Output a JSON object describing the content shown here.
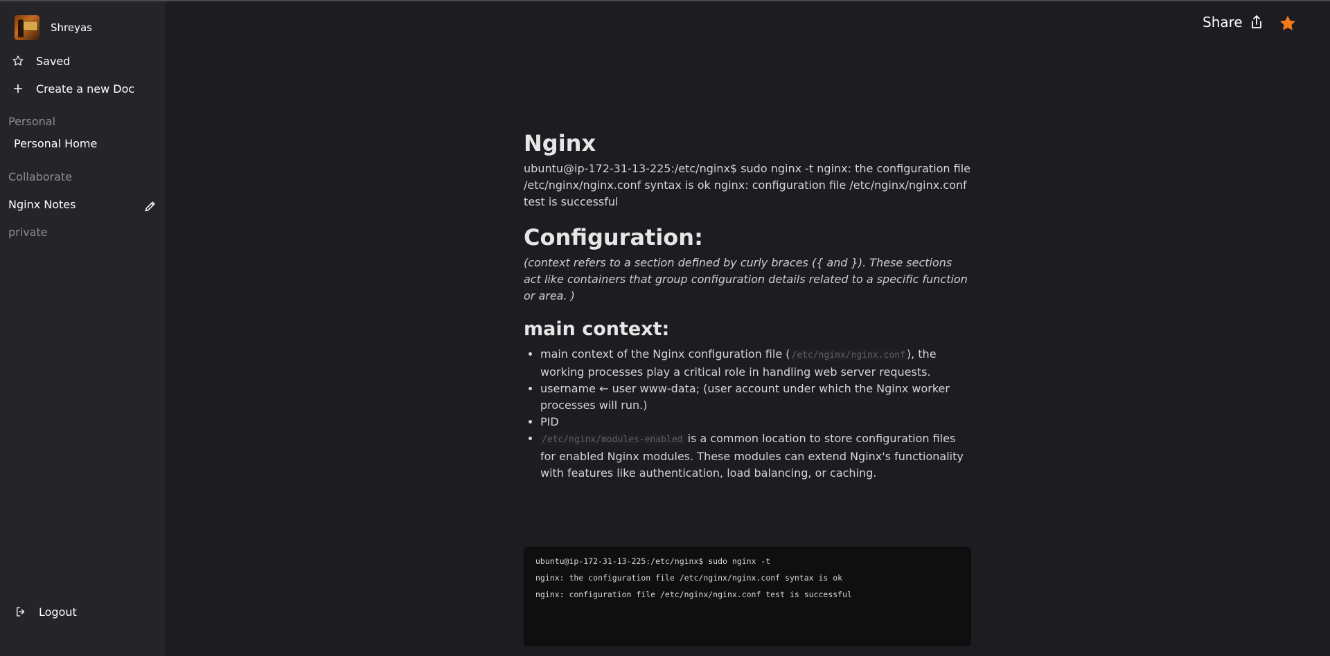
{
  "user": {
    "name": "Shreyas"
  },
  "nav": {
    "saved_label": "Saved",
    "create_label": "Create a new Doc"
  },
  "sections": {
    "personal": {
      "label": "Personal",
      "pages": [
        "Personal Home"
      ]
    },
    "collaborate": {
      "label": "Collaborate",
      "pages": [
        "Nginx Notes"
      ]
    },
    "private": {
      "label": "private"
    }
  },
  "logout_label": "Logout",
  "header": {
    "share_label": "Share"
  },
  "colors": {
    "accent_star": "#f07a1a",
    "sidebar_bg": "#252529",
    "page_bg": "#1c1c21"
  },
  "icons": [
    "star-outline-icon",
    "plus-icon",
    "pencil-icon",
    "logout-icon",
    "share-icon",
    "star-filled-icon"
  ],
  "doc": {
    "title": "Nginx",
    "intro": "ubuntu@ip-172-31-13-225:/etc/nginx$ sudo nginx -t nginx: the configuration file /etc/nginx/nginx.conf syntax is ok nginx: configuration file /etc/nginx/nginx.conf test is successful",
    "config_heading": "Configuration:",
    "config_note": "(context refers to a section defined by curly braces ({ and }). These sections act like containers that group configuration details related to a specific function or area. )",
    "main_heading": "main context:",
    "bullets": {
      "b1_before": "main context of the Nginx configuration file (",
      "b1_code": "/etc/nginx/nginx.conf",
      "b1_after": "), the working processes play a critical role in handling web server requests.",
      "b2": "username ← user www-data; (user account under which the Nginx worker processes will run.)",
      "b3": "PID",
      "b4_code": "/etc/nginx/modules-enabled",
      "b4_after": " is a common location to store configuration files for enabled Nginx modules. These modules can extend Nginx's functionality with features like authentication, load balancing, or caching."
    },
    "code_lines": [
      "ubuntu@ip-172-31-13-225:/etc/nginx$ sudo nginx -t",
      "nginx: the configuration file /etc/nginx/nginx.conf syntax is ok",
      "nginx: configuration file /etc/nginx/nginx.conf test is successful"
    ]
  }
}
